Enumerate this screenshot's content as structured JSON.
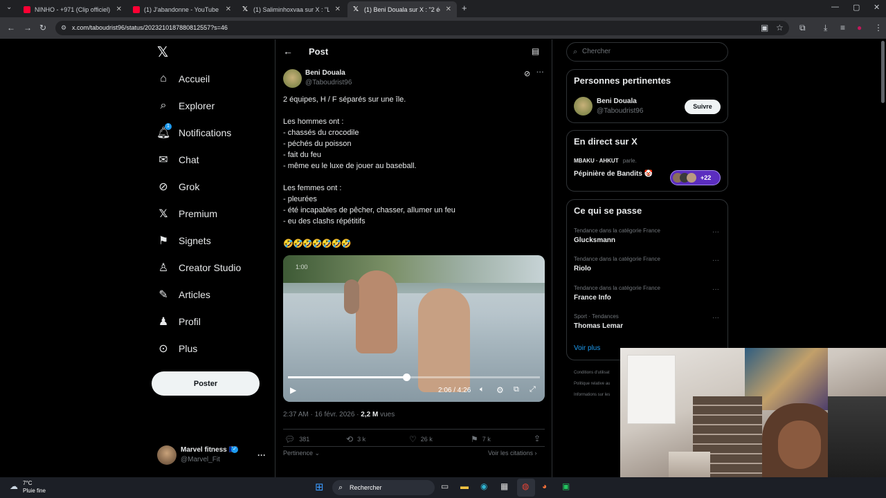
{
  "browser": {
    "tabs": [
      {
        "title": "NINHO - +971 (Clip officiel) - Y",
        "favicon": "youtube-icon",
        "color": "#ff0033"
      },
      {
        "title": "(1) J'abandonne - YouTube",
        "favicon": "youtube-icon",
        "color": "#ff0033"
      },
      {
        "title": "(1) Saliminhoxvaa sur X : \"L'ex",
        "favicon": "x-icon",
        "color": "#ffffff"
      },
      {
        "title": "(1) Beni Douala sur X : \"2 équip",
        "favicon": "x-icon",
        "color": "#ffffff"
      }
    ],
    "url": "x.com/taboudrist96/status/2023210187880812557?s=46"
  },
  "nav": {
    "items": [
      {
        "label": "Accueil",
        "icon": "home-icon"
      },
      {
        "label": "Explorer",
        "icon": "search-icon"
      },
      {
        "label": "Notifications",
        "icon": "bell-icon"
      },
      {
        "label": "Chat",
        "icon": "mail-icon"
      },
      {
        "label": "Grok",
        "icon": "grok-icon"
      },
      {
        "label": "Premium",
        "icon": "x-icon"
      },
      {
        "label": "Signets",
        "icon": "bookmark-icon"
      },
      {
        "label": "Creator Studio",
        "icon": "creator-icon"
      },
      {
        "label": "Articles",
        "icon": "article-icon"
      },
      {
        "label": "Profil",
        "icon": "user-icon"
      },
      {
        "label": "Plus",
        "icon": "more-icon"
      }
    ],
    "notification_badge": "1",
    "post_button": "Poster",
    "account": {
      "name": "Marvel fitness 🇫🇷",
      "handle": "@Marvel_Fit"
    }
  },
  "post": {
    "header_title": "Post",
    "author_name": "Beni Douala",
    "author_handle": "@Taboudrist96",
    "lines": [
      "2 équipes, H / F séparés sur une île.",
      "Les hommes ont :",
      "- chassés du crocodile",
      "- péchés du poisson",
      "- fait du feu",
      "- même eu le luxe de jouer au baseball.",
      "Les femmes ont :",
      "- pleurées",
      "- été incapables de pêcher, chasser, allumer un feu",
      "- eu des clashs répétitifs",
      "🤣🤣🤣🤣🤣🤣🤣"
    ],
    "video": {
      "badge": "1:00",
      "time": "2:06 / 4:26",
      "progress": 0.47
    },
    "timestamp": "2:37 AM · 16 févr. 2026 · ",
    "views_count": "2,2 M",
    "views_label": " vues",
    "stats": {
      "replies": "381",
      "reposts": "3 k",
      "likes": "26 k",
      "bookmarks": "7 k"
    },
    "sort_label": "Pertinence",
    "quotes_label": "Voir les citations"
  },
  "sidebar": {
    "search_placeholder": "Chercher",
    "relevant": {
      "title": "Personnes pertinentes",
      "name": "Beni Douala",
      "handle": "@Taboudrist96",
      "follow": "Suivre"
    },
    "live": {
      "title": "En direct sur X",
      "hosts": "MBAKU · AHKUT",
      "speaking": "parle.",
      "space": "Pépinière de Bandits 🤡",
      "listeners": "+22"
    },
    "trends": {
      "title": "Ce qui se passe",
      "items": [
        {
          "category": "Tendance dans la catégorie France",
          "name": "Glucksmann"
        },
        {
          "category": "Tendance dans la catégorie France",
          "name": "Riolo"
        },
        {
          "category": "Tendance dans la catégorie France",
          "name": "France Info"
        },
        {
          "category": "Sport · Tendances",
          "name": "Thomas Lemar"
        }
      ],
      "more": "Voir plus"
    },
    "footer": [
      "Conditions d'utilisat",
      "Politique relative au",
      "Informations sur les"
    ]
  },
  "taskbar": {
    "temp": "7°C",
    "weather": "Pluie fine",
    "search": "Rechercher"
  }
}
